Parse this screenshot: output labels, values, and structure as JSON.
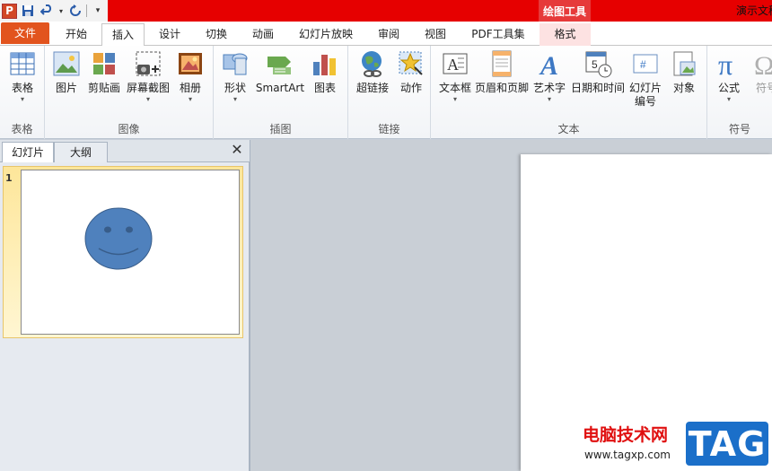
{
  "quick_access": {
    "app_logo": "P",
    "save_icon": "save-icon",
    "undo_icon": "undo-icon",
    "redo_icon": "redo-icon",
    "customize_icon": "customize-qat-icon"
  },
  "title": {
    "context_label": "绘图工具",
    "doc_title": "演示文稿"
  },
  "tabs": [
    {
      "label": "文件"
    },
    {
      "label": "开始"
    },
    {
      "label": "插入"
    },
    {
      "label": "设计"
    },
    {
      "label": "切换"
    },
    {
      "label": "动画"
    },
    {
      "label": "幻灯片放映"
    },
    {
      "label": "审阅"
    },
    {
      "label": "视图"
    },
    {
      "label": "PDF工具集"
    },
    {
      "label": "格式"
    }
  ],
  "ribbon": {
    "groups": {
      "table": "表格",
      "image": "图像",
      "illustration": "插图",
      "link": "链接",
      "text": "文本",
      "symbol": "符号"
    },
    "buttons": {
      "table": "表格",
      "picture": "图片",
      "clipart": "剪贴画",
      "screenshot": "屏幕截图",
      "album": "相册",
      "shapes": "形状",
      "smartart": "SmartArt",
      "chart": "图表",
      "hyperlink": "超链接",
      "action": "动作",
      "textbox": "文本框",
      "header_footer": "页眉和页脚",
      "wordart": "艺术字",
      "datetime": "日期和时间",
      "slide_number_1": "幻灯片",
      "slide_number_2": "编号",
      "object": "对象",
      "equation": "公式",
      "symbol": "符号"
    }
  },
  "panel": {
    "tab_slides": "幻灯片",
    "tab_outline": "大纲",
    "close": "✕",
    "slide_number": "1"
  },
  "watermark": {
    "text": "电脑技术网",
    "url": "www.tagxp.com",
    "tag": "TAG"
  },
  "colors": {
    "title_red": "#e60000",
    "file_tab": "#e2541e",
    "smiley_fill": "#4f81bd",
    "smiley_stroke": "#385d8a",
    "tag_blue": "#1b6fc9"
  }
}
